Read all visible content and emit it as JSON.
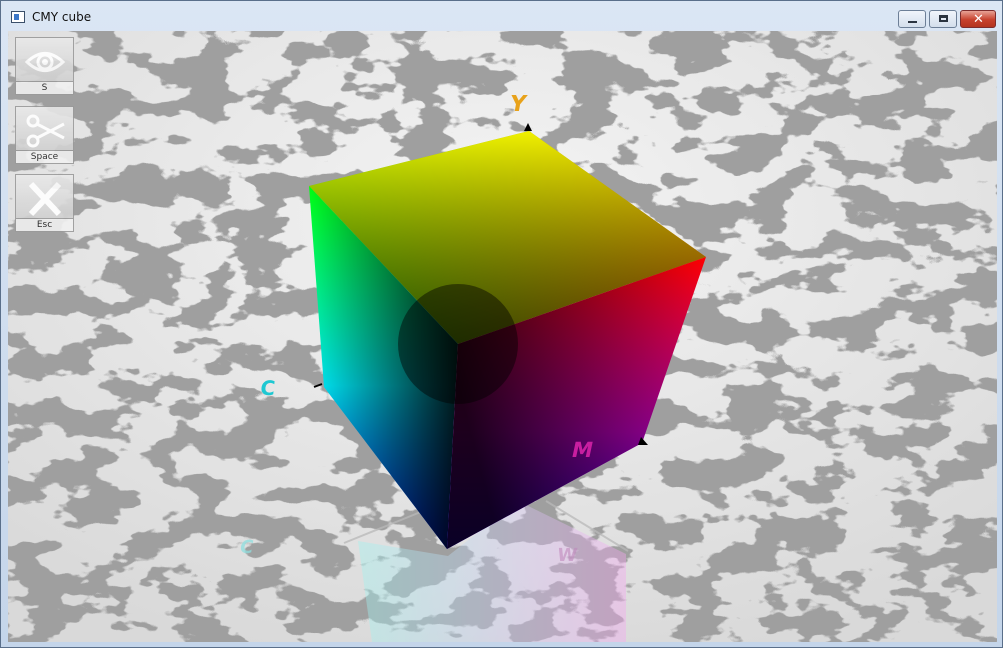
{
  "window": {
    "title": "CMY cube",
    "minimize_icon": "minimize-icon",
    "maximize_icon": "maximize-icon",
    "close_icon": "close-icon"
  },
  "toolbar": {
    "items": [
      {
        "icon": "eye-icon",
        "key": "S"
      },
      {
        "icon": "scissors-icon",
        "key": "Space"
      },
      {
        "icon": "close-x-icon",
        "key": "Esc"
      }
    ]
  },
  "scene": {
    "axis_labels": {
      "y": "Y",
      "c": "C",
      "m": "M",
      "reflection_c": "C",
      "reflection_w": "W"
    },
    "colors": {
      "cyan": "#00ffff",
      "magenta": "#ff00ff",
      "yellow": "#ffff00",
      "red": "#ff0000",
      "green": "#00ff00",
      "blue": "#0000ff",
      "black": "#000000",
      "label_y": "#e8a21a",
      "label_c": "#1ec8d2",
      "label_m": "#c81ea0"
    }
  }
}
